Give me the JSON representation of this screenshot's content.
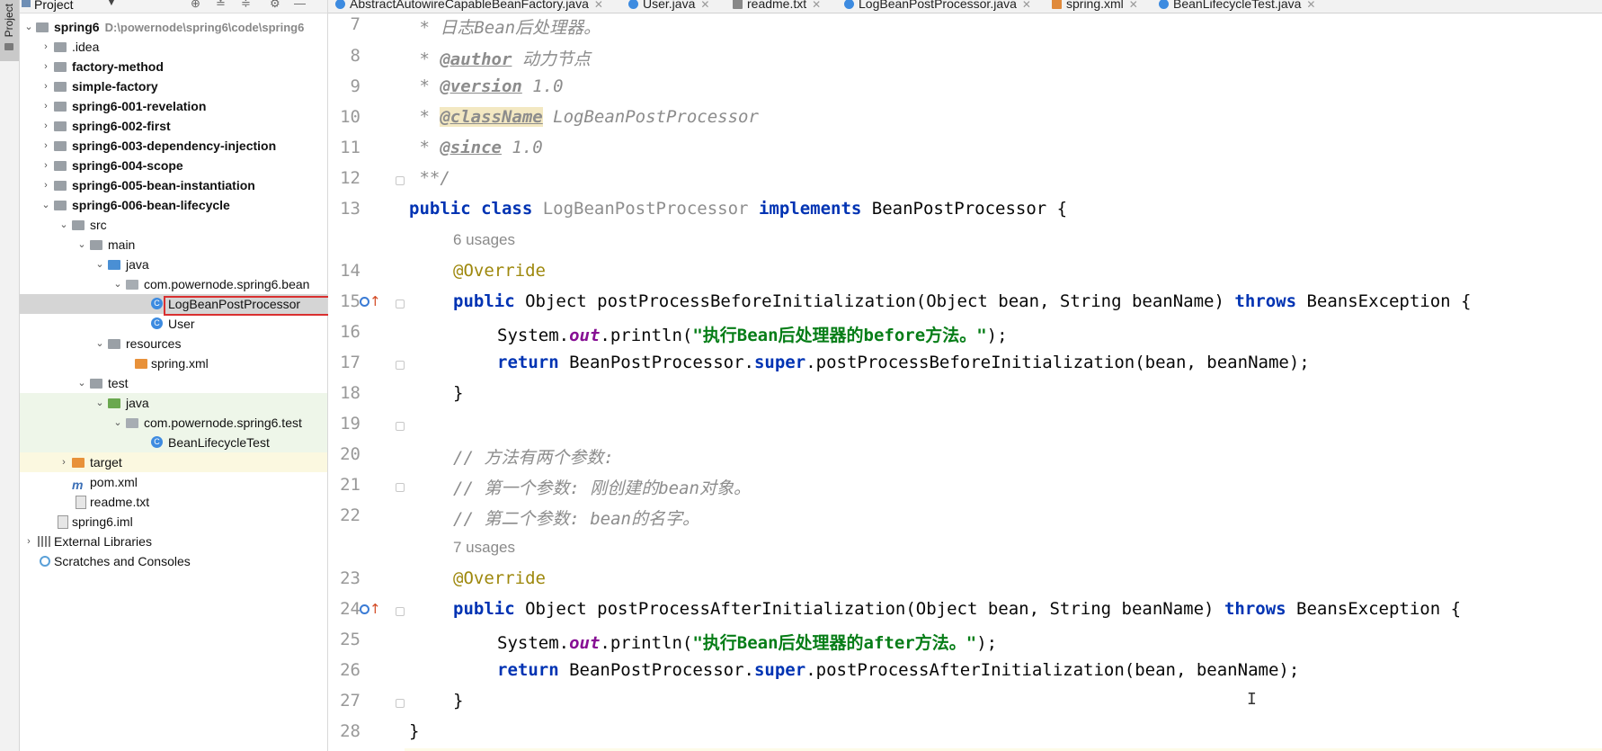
{
  "side_stripe": {
    "label": "Project"
  },
  "project_panel": {
    "title": "Project",
    "dropdown": "▼",
    "tools": [
      "⊕",
      "≚",
      "≑",
      "⚙",
      "—"
    ],
    "tree": [
      {
        "label": "spring6",
        "path": "D:\\powernode\\spring6\\code\\spring6",
        "bold": true,
        "expanded": true,
        "depth": 0,
        "icon": "folder"
      },
      {
        "label": ".idea",
        "depth": 1,
        "icon": "folder"
      },
      {
        "label": "factory-method",
        "bold": true,
        "depth": 1,
        "icon": "module"
      },
      {
        "label": "simple-factory",
        "bold": true,
        "depth": 1,
        "icon": "module"
      },
      {
        "label": "spring6-001-revelation",
        "bold": true,
        "depth": 1,
        "icon": "module"
      },
      {
        "label": "spring6-002-first",
        "bold": true,
        "depth": 1,
        "icon": "module"
      },
      {
        "label": "spring6-003-dependency-injection",
        "bold": true,
        "depth": 1,
        "icon": "module"
      },
      {
        "label": "spring6-004-scope",
        "bold": true,
        "depth": 1,
        "icon": "module"
      },
      {
        "label": "spring6-005-bean-instantiation",
        "bold": true,
        "depth": 1,
        "icon": "module"
      },
      {
        "label": "spring6-006-bean-lifecycle",
        "bold": true,
        "expanded": true,
        "depth": 1,
        "icon": "module"
      },
      {
        "label": "src",
        "expanded": true,
        "depth": 2,
        "icon": "folder"
      },
      {
        "label": "main",
        "expanded": true,
        "depth": 3,
        "icon": "folder"
      },
      {
        "label": "java",
        "expanded": true,
        "depth": 4,
        "icon": "source"
      },
      {
        "label": "com.powernode.spring6.bean",
        "expanded": true,
        "depth": 5,
        "icon": "package"
      },
      {
        "label": "LogBeanPostProcessor",
        "depth": 6,
        "icon": "class",
        "selected": true
      },
      {
        "label": "User",
        "depth": 6,
        "icon": "class"
      },
      {
        "label": "resources",
        "expanded": true,
        "depth": 4,
        "icon": "resources"
      },
      {
        "label": "spring.xml",
        "depth": 5,
        "icon": "xml"
      },
      {
        "label": "test",
        "expanded": true,
        "depth": 3,
        "icon": "folder"
      },
      {
        "label": "java",
        "expanded": true,
        "depth": 4,
        "icon": "test-source"
      },
      {
        "label": "com.powernode.spring6.test",
        "expanded": true,
        "depth": 5,
        "icon": "package"
      },
      {
        "label": "BeanLifecycleTest",
        "depth": 6,
        "icon": "test-class"
      },
      {
        "label": "target",
        "depth": 2,
        "icon": "excluded"
      },
      {
        "label": "pom.xml",
        "depth": 2,
        "icon": "maven"
      },
      {
        "label": "readme.txt",
        "depth": 2,
        "icon": "text"
      },
      {
        "label": "spring6.iml",
        "depth": 1,
        "icon": "iml"
      },
      {
        "label": "External Libraries",
        "depth": 0,
        "icon": "libraries"
      },
      {
        "label": "Scratches and Consoles",
        "depth": 0,
        "icon": "scratches"
      }
    ]
  },
  "tabs": [
    {
      "label": "AbstractAutowireCapableBeanFactory.java",
      "icon": "class"
    },
    {
      "label": "User.java",
      "icon": "class"
    },
    {
      "label": "readme.txt",
      "icon": "file"
    },
    {
      "label": "LogBeanPostProcessor.java",
      "icon": "class",
      "active": true
    },
    {
      "label": "spring.xml",
      "icon": "xml"
    },
    {
      "label": "BeanLifecycleTest.java",
      "icon": "class"
    }
  ],
  "editor": {
    "line_numbers": [
      "7",
      "8",
      "9",
      "10",
      "11",
      "12",
      "13",
      "14",
      "15",
      "16",
      "17",
      "18",
      "19",
      "20",
      "21",
      "22",
      "23",
      "24",
      "25",
      "26",
      "27",
      "28"
    ],
    "usages_1": "6 usages",
    "usages_2": "7 usages",
    "code": {
      "l7_star": " * ",
      "l7_text": "日志Bean后处理器。",
      "l8_star": " * ",
      "l8_tag": "@author",
      "l8_text": " 动力节点",
      "l9_star": " * ",
      "l9_tag": "@version",
      "l9_text": " 1.0",
      "l10_star": " * ",
      "l10_tag": "@className",
      "l10_text": " LogBeanPostProcessor",
      "l11_star": " * ",
      "l11_tag": "@since",
      "l11_text": " 1.0",
      "l12": " **/",
      "l13_kw1": "public class",
      "l13_name": " LogBeanPostProcessor ",
      "l13_kw2": "implements",
      "l13_rest": " BeanPostProcessor {",
      "override": "@Override",
      "l15_kw": "public",
      "l15_a": " Object postProcessBeforeInitialization(Object bean, String beanName) ",
      "l15_throws": "throws",
      "l15_b": " BeansException {",
      "l16_a": "System.",
      "l16_out": "out",
      "l16_b": ".println(",
      "l16_str": "\"执行Bean后处理器的before方法。\"",
      "l16_c": ");",
      "l17_kw": "return",
      "l17_a": " BeanPostProcessor.",
      "l17_super": "super",
      "l17_b": ".postProcessBeforeInitialization(bean, beanName);",
      "close_inner": "}",
      "l20": "// 方法有两个参数:",
      "l21": "// 第一个参数: 刚创建的bean对象。",
      "l22": "// 第二个参数: bean的名字。",
      "l24_kw": "public",
      "l24_a": " Object postProcessAfterInitialization(Object bean, String beanName) ",
      "l24_throws": "throws",
      "l24_b": " BeansException {",
      "l25_a": "System.",
      "l25_out": "out",
      "l25_b": ".println(",
      "l25_str": "\"执行Bean后处理器的after方法。\"",
      "l25_c": ");",
      "l26_kw": "return",
      "l26_a": " BeanPostProcessor.",
      "l26_super": "super",
      "l26_b": ".postProcessAfterInitialization(bean, beanName);",
      "close_outer": "}"
    }
  },
  "colors": {
    "keyword": "#0033b3",
    "string": "#067d17",
    "annotation": "#9e880d",
    "comment": "#8c8c8c",
    "static_field": "#871094",
    "selection_box": "#d93030",
    "active_tab": "#4083c9"
  }
}
